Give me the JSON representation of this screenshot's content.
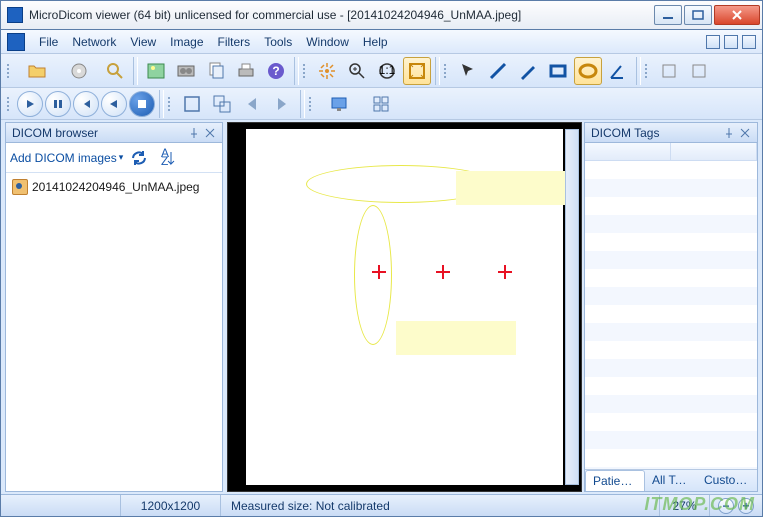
{
  "window": {
    "title": "MicroDicom viewer (64 bit) unlicensed for commercial use - [20141024204946_UnMAA.jpeg]"
  },
  "menu": {
    "items": [
      "File",
      "Network",
      "View",
      "Image",
      "Filters",
      "Tools",
      "Window",
      "Help"
    ]
  },
  "browser": {
    "title": "DICOM browser",
    "add_label": "Add DICOM images",
    "file": "20141024204946_UnMAA.jpeg"
  },
  "tags_panel": {
    "title": "DICOM Tags",
    "tabs": [
      "Patient inf..",
      "All Tags",
      "Custom Ta.."
    ]
  },
  "status": {
    "dimensions": "1200x1200",
    "measured": "Measured size: Not calibrated",
    "zoom": "27%"
  },
  "watermark": "ITMOP.COM"
}
